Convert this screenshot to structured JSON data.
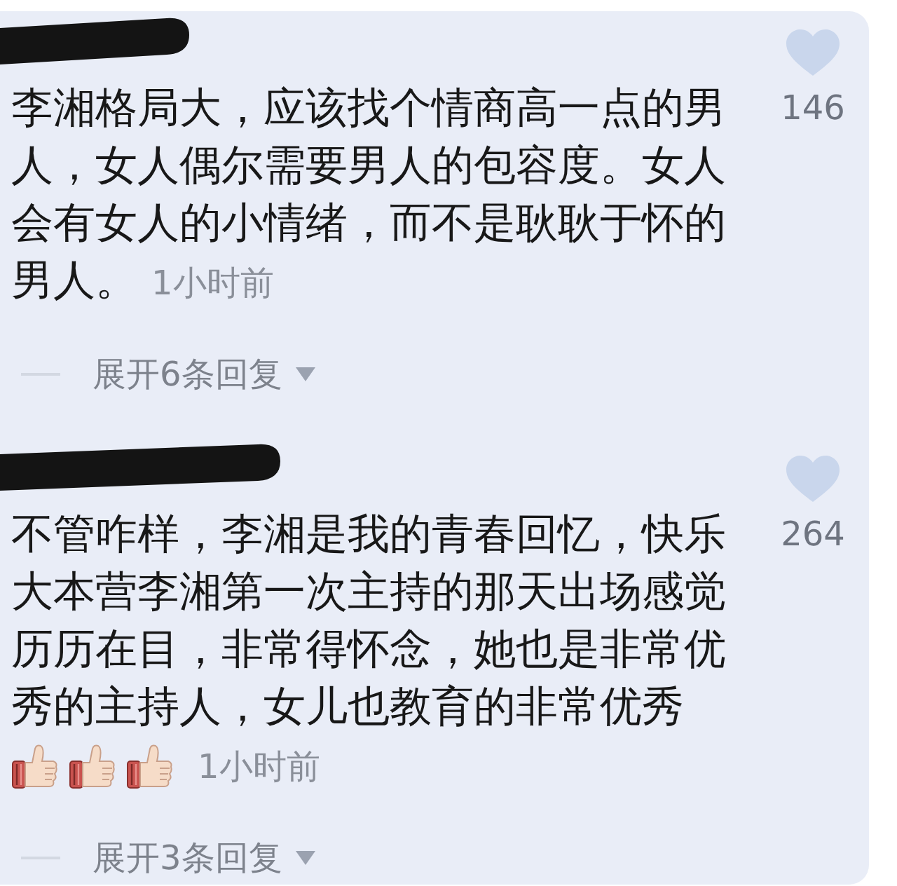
{
  "comments": [
    {
      "lines": [
        "李湘格局大，应该找个情商高一点的男",
        "人，女人偶尔需要男人的包容度。女人",
        "会有女人的小情绪，而不是耿耿于怀的",
        "男人。"
      ],
      "time": "1小时前",
      "liked": false,
      "likes": "146",
      "replies_link": "展开6条回复"
    },
    {
      "lines": [
        "不管咋样，李湘是我的青春回忆，快乐",
        "大本营李湘第一次主持的那天出场感觉",
        "历历在目，非常得怀念，她也是非常优",
        "秀的主持人，女儿也教育的非常优秀"
      ],
      "emojis": [
        {
          "kind": "thumbs_up"
        },
        {
          "kind": "thumbs_up"
        },
        {
          "kind": "thumbs_up"
        }
      ],
      "time": "1小时前",
      "liked": false,
      "likes": "264",
      "replies_link": "展开3条回复"
    }
  ]
}
